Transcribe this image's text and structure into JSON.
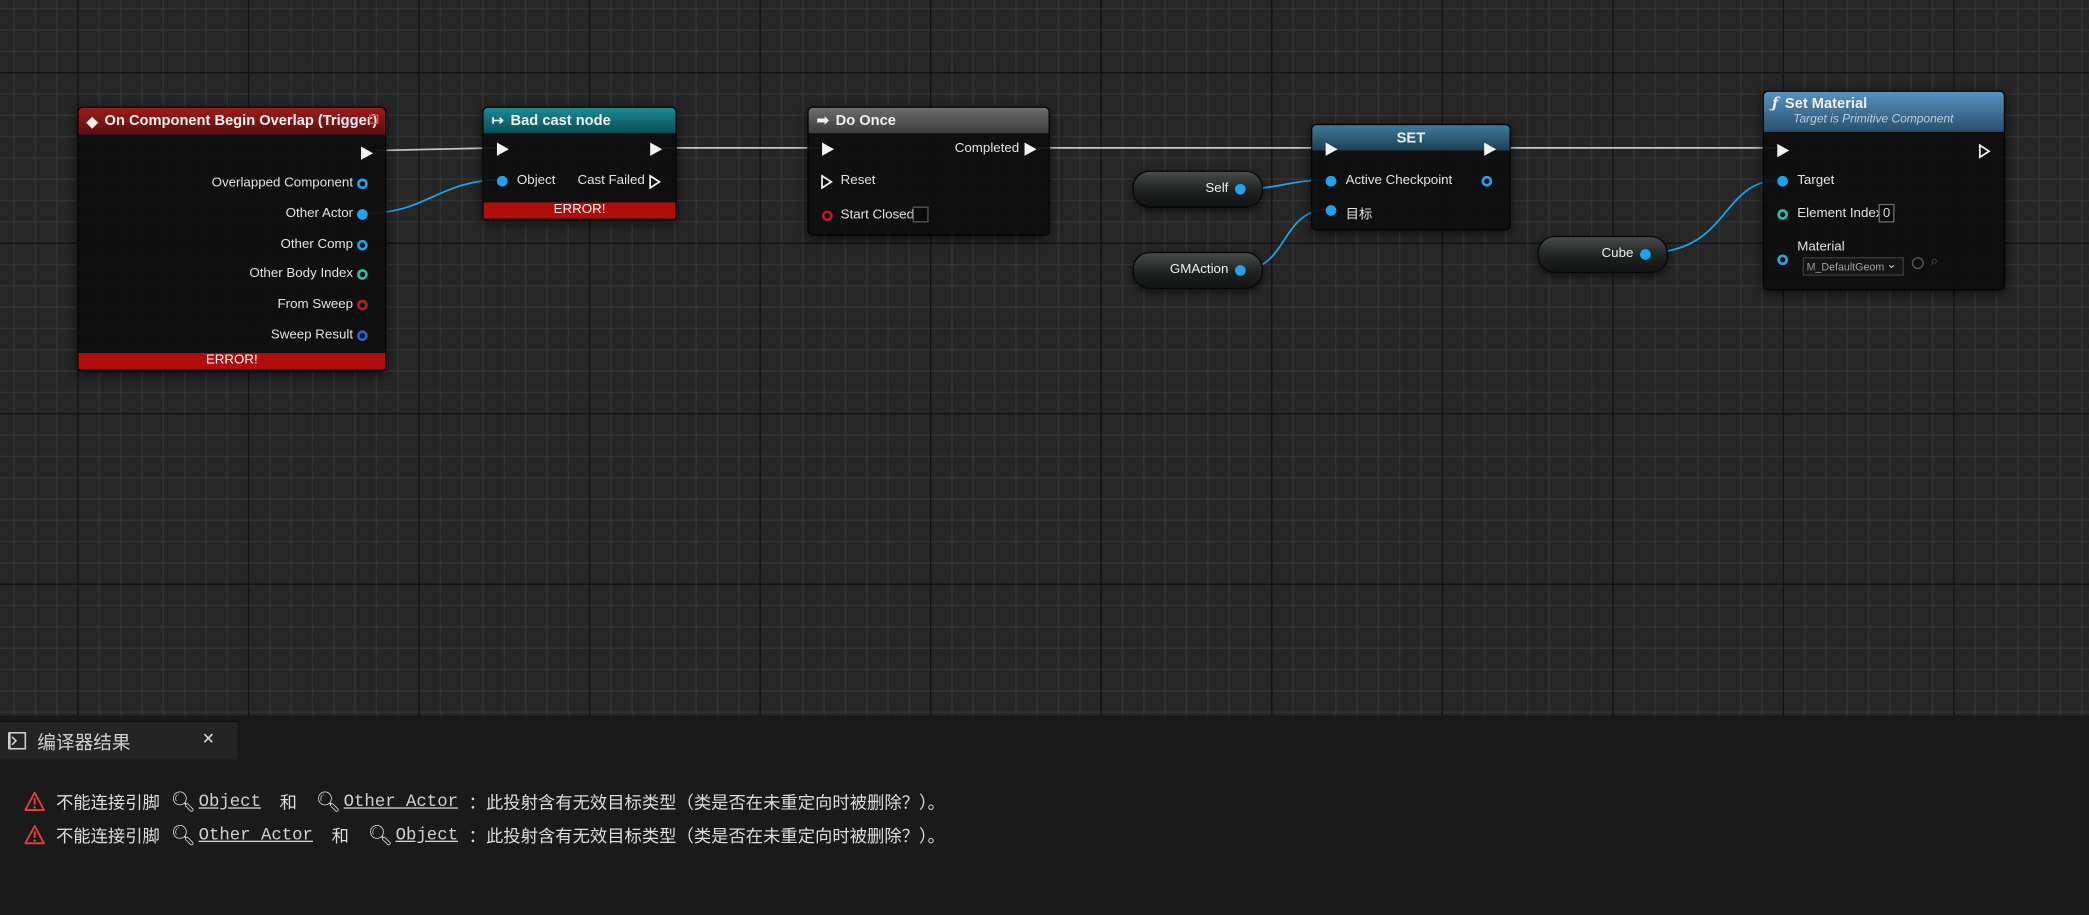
{
  "nodes": {
    "overlap": {
      "title": "On Component Begin Overlap (Trigger)",
      "pins": [
        "Overlapped Component",
        "Other Actor",
        "Other Comp",
        "Other Body Index",
        "From Sweep",
        "Sweep Result"
      ],
      "error": "ERROR!"
    },
    "cast": {
      "title": "Bad cast node",
      "object": "Object",
      "cast_failed": "Cast Failed",
      "error": "ERROR!"
    },
    "do_once": {
      "title": "Do Once",
      "completed": "Completed",
      "reset": "Reset",
      "start_closed": "Start Closed"
    },
    "set": {
      "title": "SET",
      "active_checkpoint": "Active Checkpoint",
      "target": "目标"
    },
    "set_material": {
      "title": "Set Material",
      "subtitle": "Target is Primitive Component",
      "target": "Target",
      "element_index": "Element Index",
      "element_index_value": "0",
      "material": "Material",
      "material_value": "M_DefaultGeom"
    },
    "vars": {
      "self": "Self",
      "gmaction": "GMAction",
      "cube": "Cube"
    }
  },
  "compiler": {
    "tab_title": "编译器结果",
    "messages": [
      {
        "prefix": "不能连接引脚",
        "a": "Object",
        "and": "和",
        "b": "Other Actor",
        "suffix": "：此投射含有无效目标类型（类是否在未重定向时被删除？）。"
      },
      {
        "prefix": "不能连接引脚",
        "a": "Other Actor",
        "and": "和",
        "b": "Object",
        "suffix": "：此投射含有无效目标类型（类是否在未重定向时被删除？）。"
      }
    ]
  },
  "colors": {
    "event_header": "#8a1616",
    "cast_header": "#11707a",
    "flow_header": "#555555",
    "var_header": "#2a5670",
    "func_header": "#4a7ea8",
    "object_pin": "#1fa3ec",
    "error": "#b20d0d"
  }
}
